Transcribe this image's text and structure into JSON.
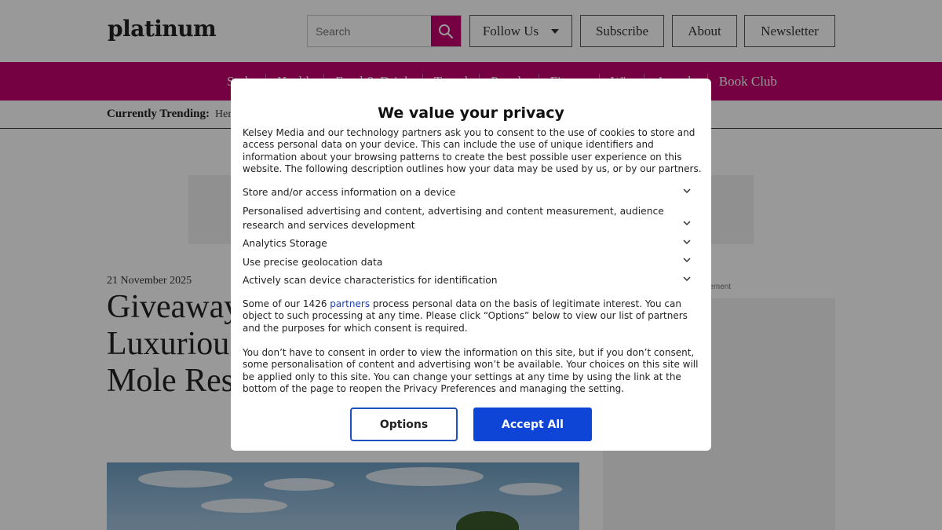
{
  "header": {
    "logo": "platinum",
    "search_placeholder": "Search",
    "follow_label": "Follow Us",
    "subscribe_label": "Subscribe",
    "about_label": "About",
    "newsletter_label": "Newsletter"
  },
  "nav": {
    "items": [
      "Style",
      "Health",
      "Food & Drink",
      "Travel",
      "People",
      "Fitness",
      "Win",
      "Awards",
      "Book Club"
    ]
  },
  "trending": {
    "label": "Currently Trending:",
    "value": "Her"
  },
  "article": {
    "date": "21 November 2025",
    "headline_lines": [
      "Giveaway",
      "Luxurious",
      "Mole Res"
    ]
  },
  "sidebar": {
    "ad_label": "rtisement"
  },
  "consent": {
    "title": "We value your privacy",
    "intro": "Kelsey Media and our technology partners ask you to consent to the use of cookies to store and access personal data on your device. This can include the use of unique identifiers and information about your browsing patterns to create the best possible user experience on this website. The following description outlines how your data may be used by us, or by our partners.",
    "purposes": [
      "Store and/or access information on a device",
      "Personalised advertising and content, advertising and content measurement, audience research and services development",
      "Analytics Storage",
      "Use precise geolocation data",
      "Actively scan device characteristics for identification"
    ],
    "legit_prefix": "Some of our 1426 ",
    "legit_link": "partners",
    "legit_suffix": " process personal data on the basis of legitimate interest. You can object to such processing at any time. Please click “Options” below to view our list of partners and the purposes for which consent is required.",
    "no_consent": "You don’t have to consent in order to view the information on this site, but if you don’t consent, some personalisation of content and advertising won’t be available. Your choices on this site will be applied only to this site. You can change your settings at any time by using the link at the bottom of the page to reopen the Privacy Preferences and managing the setting.",
    "options_label": "Options",
    "accept_label": "Accept All"
  },
  "colors": {
    "brand": "#c4006f",
    "accept": "#0f45d6",
    "link": "#1a3fb0"
  }
}
